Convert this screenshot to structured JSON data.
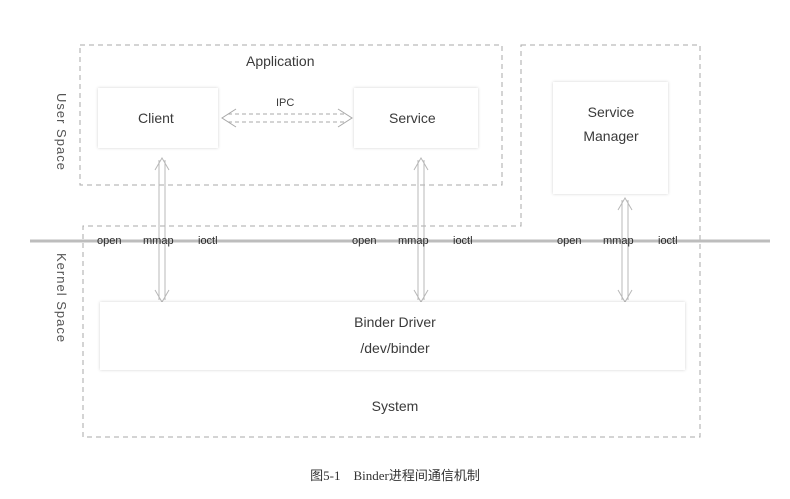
{
  "diagram": {
    "user_space_label": "User Space",
    "kernel_space_label": "Kernel Space",
    "application_label": "Application",
    "client_label": "Client",
    "service_label": "Service",
    "ipc_label": "IPC",
    "service_manager_label": "Service Manager",
    "binder_driver_label": "Binder Driver",
    "dev_binder_label": "/dev/binder",
    "system_label": "System",
    "api_groups": [
      {
        "open": "open",
        "mmap": "mmap",
        "ioctl": "ioctl"
      },
      {
        "open": "open",
        "mmap": "mmap",
        "ioctl": "ioctl"
      },
      {
        "open": "open",
        "mmap": "mmap",
        "ioctl": "ioctl"
      }
    ]
  },
  "caption": "图5-1　Binder进程间通信机制"
}
